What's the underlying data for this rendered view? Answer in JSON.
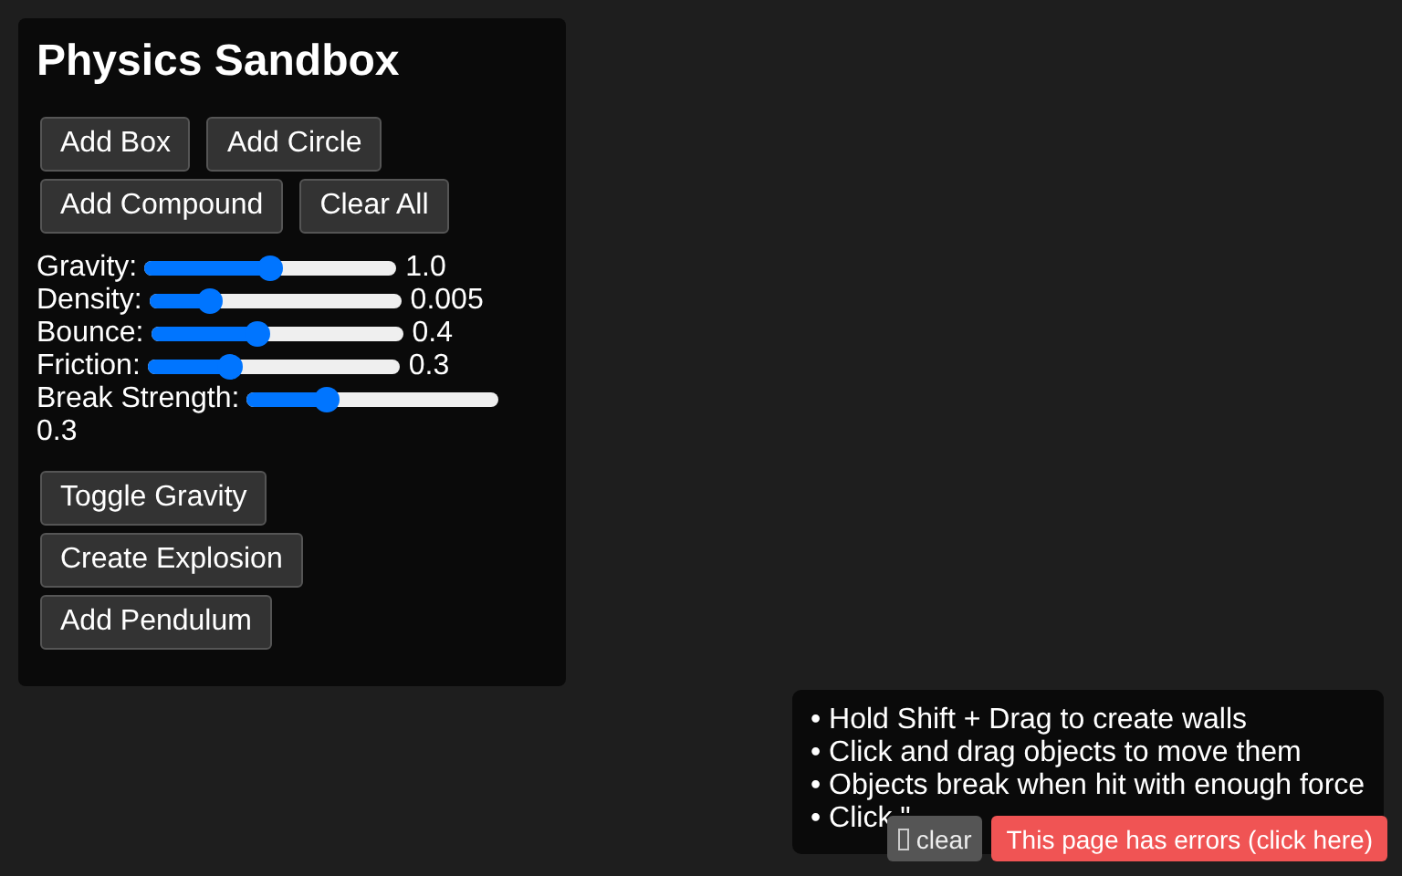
{
  "panel": {
    "title": "Physics Sandbox",
    "button_rows": [
      [
        "Add Box",
        "Add Circle"
      ],
      [
        "Add Compound",
        "Clear All"
      ]
    ],
    "sliders": [
      {
        "label": "Gravity:",
        "level": 0.5,
        "reading": "1.0"
      },
      {
        "label": "Density:",
        "level": 0.24,
        "reading": "0.005"
      },
      {
        "label": "Bounce:",
        "level": 0.42,
        "reading": "0.4"
      },
      {
        "label": "Friction:",
        "level": 0.33,
        "reading": "0.3"
      },
      {
        "label": "Break Strength:",
        "level": 0.32,
        "reading": "0.3"
      }
    ],
    "actions": [
      "Toggle Gravity",
      "Create Explosion",
      "Add Pendulum"
    ]
  },
  "help": {
    "lines": [
      "• Hold Shift + Drag to create walls",
      "• Click and drag objects to move them",
      "• Objects break when hit with enough force",
      "• Click \""
    ]
  },
  "overlay": {
    "clear_button": "clear",
    "error_button": "This page has errors (click here)"
  }
}
